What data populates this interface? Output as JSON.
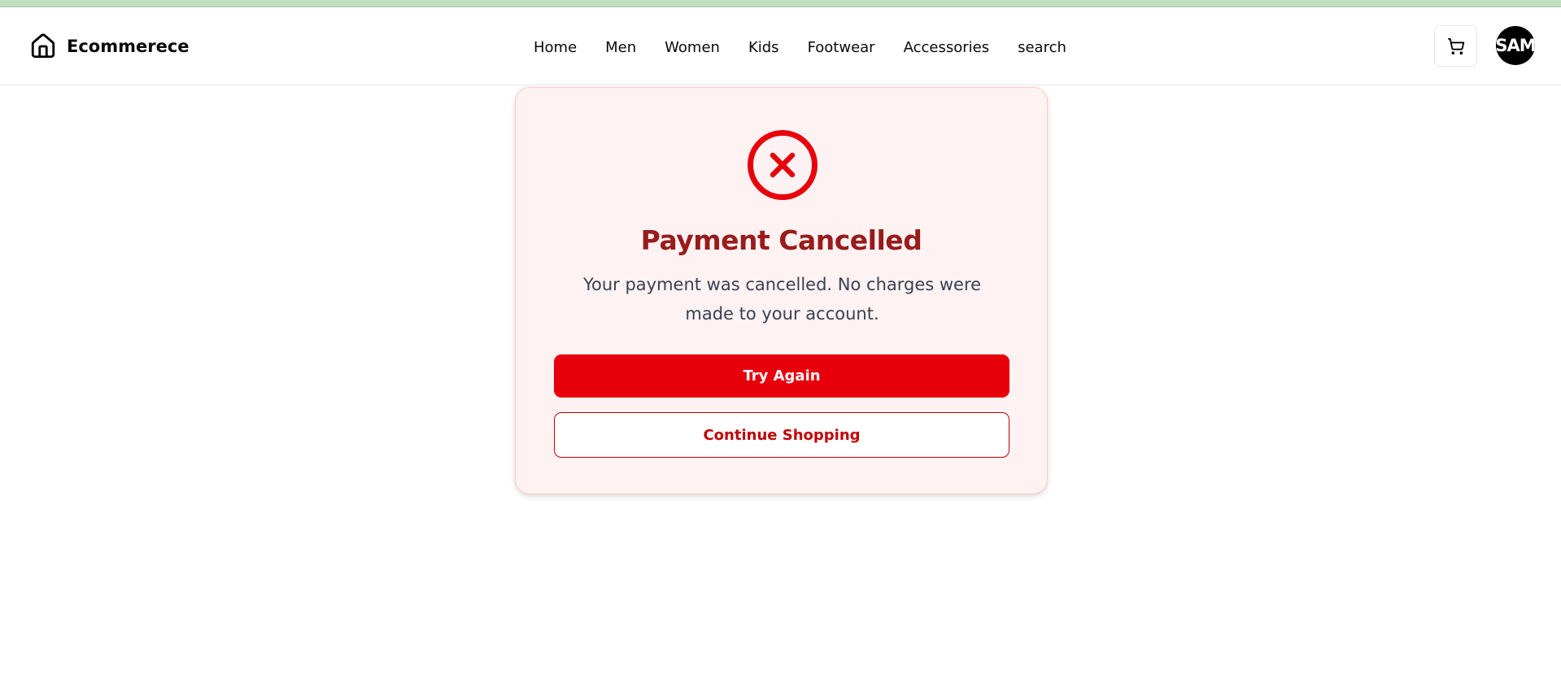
{
  "header": {
    "brand_icon": "home-icon",
    "brand_name": "Ecommerece",
    "nav": [
      {
        "label": "Home"
      },
      {
        "label": "Men"
      },
      {
        "label": "Women"
      },
      {
        "label": "Kids"
      },
      {
        "label": "Footwear"
      },
      {
        "label": "Accessories"
      },
      {
        "label": "search"
      }
    ],
    "cart_icon": "shopping-cart-icon",
    "avatar_initials": "SAM"
  },
  "card": {
    "status_icon": "x-circle-icon",
    "title": "Payment Cancelled",
    "message": "Your payment was cancelled. No charges were made to your account.",
    "primary_button": "Try Again",
    "secondary_button": "Continue Shopping"
  },
  "colors": {
    "top_strip": "#c2dfc0",
    "card_background": "#fef2f2",
    "card_border": "#fecaca",
    "icon_red": "#e7000b",
    "title_red": "#991b1b",
    "button_red": "#e7000b",
    "outline_red": "#c10007",
    "message_gray": "#374151"
  }
}
